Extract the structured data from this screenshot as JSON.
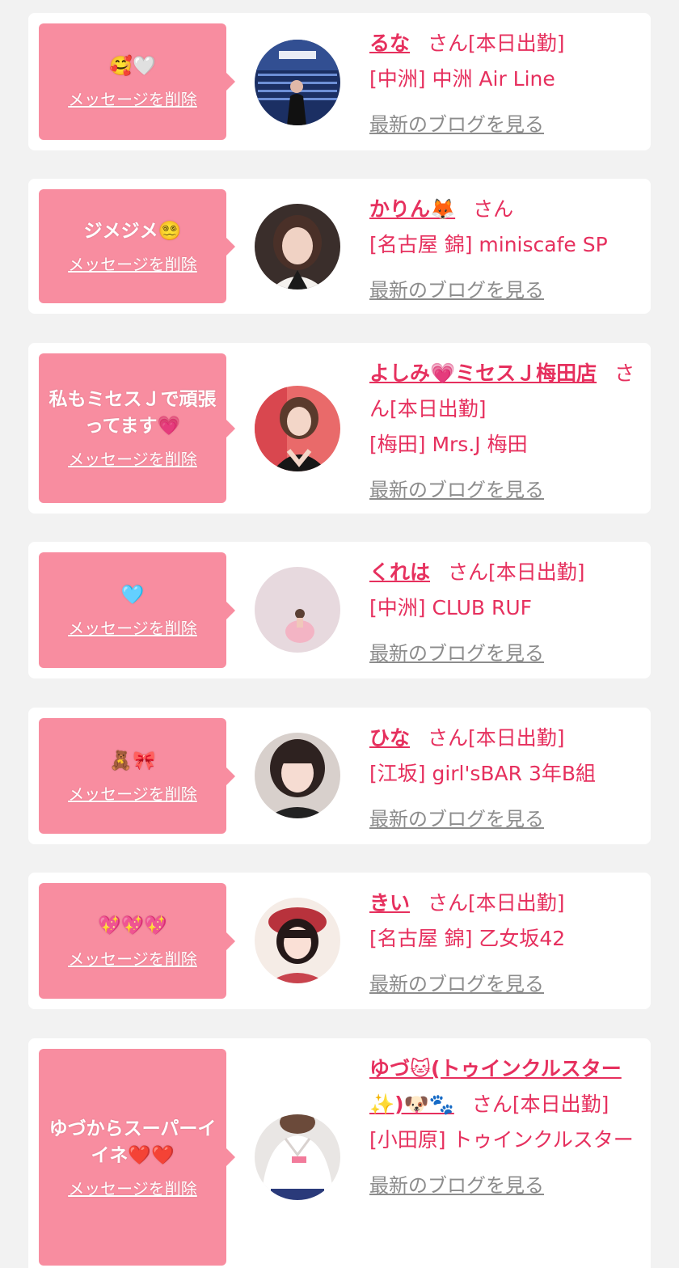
{
  "delete_label": "メッセージを削除",
  "san_label": "さん",
  "blog_label": "最新のブログを見る",
  "items": [
    {
      "message": "🥰🤍",
      "name": "るな",
      "status": "[本日出勤]",
      "shop": "[中洲] 中洲 Air Line",
      "avatar": "photo-airport"
    },
    {
      "message": "ジメジメ😵‍💫",
      "name": "かりん🦊",
      "status": "",
      "shop": "[名古屋 錦] miniscafe SP",
      "avatar": "photo-portrait-dark"
    },
    {
      "message": "私もミセスＪで頑張ってます💗",
      "name": "よしみ💗ミセスＪ梅田店",
      "status": "[本日出勤]",
      "shop": "[梅田] Mrs.J 梅田",
      "avatar": "photo-red-background"
    },
    {
      "message": "🩵",
      "name": "くれは",
      "status": "[本日出勤]",
      "shop": "[中洲] CLUB RUF",
      "avatar": "photo-pink-dress"
    },
    {
      "message": "🧸🎀",
      "name": "ひな",
      "status": "[本日出勤]",
      "shop": "[江坂] girl'sBAR 3年B組",
      "avatar": "photo-portrait-bangs"
    },
    {
      "message": "💖💖💖",
      "name": "きい",
      "status": "[本日出勤]",
      "shop": "[名古屋 錦] 乙女坂42",
      "avatar": "photo-beret"
    },
    {
      "message": "ゆづからスーパーイイネ❤️❤️",
      "name": "ゆづ🐱(トゥインクルスター✨)🐶🐾",
      "status": "[本日出勤]",
      "shop": "[小田原] トゥインクルスター",
      "avatar": "photo-white-shirt"
    }
  ],
  "colors": {
    "bubble": "#f88da0",
    "accent": "#e6305e",
    "link_gray": "#8c8c8c",
    "background": "#f2f2f2"
  }
}
